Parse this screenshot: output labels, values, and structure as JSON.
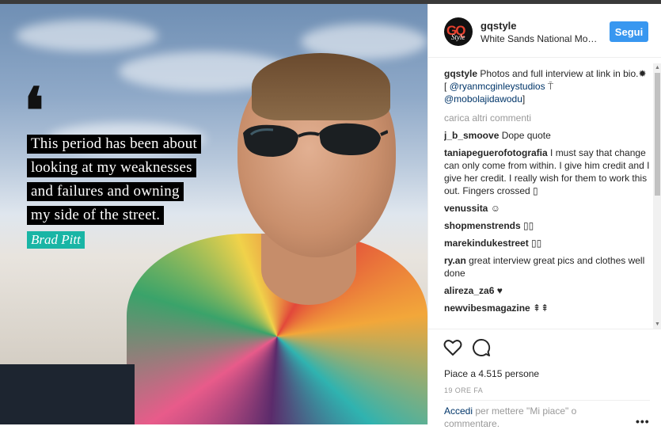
{
  "post": {
    "quote_mark": "❛",
    "quote_lines": [
      "This period has been about",
      "looking at my weaknesses",
      "and failures and owning",
      "my side of the street."
    ],
    "author": "Brad Pitt"
  },
  "header": {
    "username": "gqstyle",
    "location": "White Sands National Monument",
    "follow_label": "Segui",
    "avatar_letters": "GQ",
    "avatar_sub": "Style"
  },
  "caption": {
    "username": "gqstyle",
    "text_1": " Photos and full interview at link in bio.",
    "text_2": "✹ [",
    "mention_1": "@ryanmcginleystudios",
    "text_3": " ⍑ ",
    "mention_2": "@mobolajidawodu",
    "text_4": "]"
  },
  "load_more": "carica altri commenti",
  "comments": [
    {
      "user": "j_b_smoove",
      "text": " Dope quote"
    },
    {
      "user": "taniapeguerofotografia",
      "text": " I must say that change can only come from within. I give him credit and I give her credit. I really wish for them to work this out. Fingers crossed ▯"
    },
    {
      "user": "venussita",
      "text": " ☺"
    },
    {
      "user": "shopmenstrends",
      "text": " ▯▯"
    },
    {
      "user": "marekindukestreet",
      "text": " ▯▯"
    },
    {
      "user": "ry.an",
      "text": " great interview great pics and clothes well done"
    },
    {
      "user": "alireza_za6",
      "text": " ♥"
    },
    {
      "user": "newvibesmagazine",
      "text": " ⇞⇞"
    }
  ],
  "actions": {
    "likes": "Piace a 4.515 persone",
    "time": "19 ORE FA",
    "login_link": "Accedi",
    "login_rest": " per mettere \"Mi piace\" o commentare.",
    "more_label": "•••"
  },
  "colors": {
    "follow_button": "#3897f0",
    "author_tag": "#19b5a5",
    "link": "#003569"
  }
}
